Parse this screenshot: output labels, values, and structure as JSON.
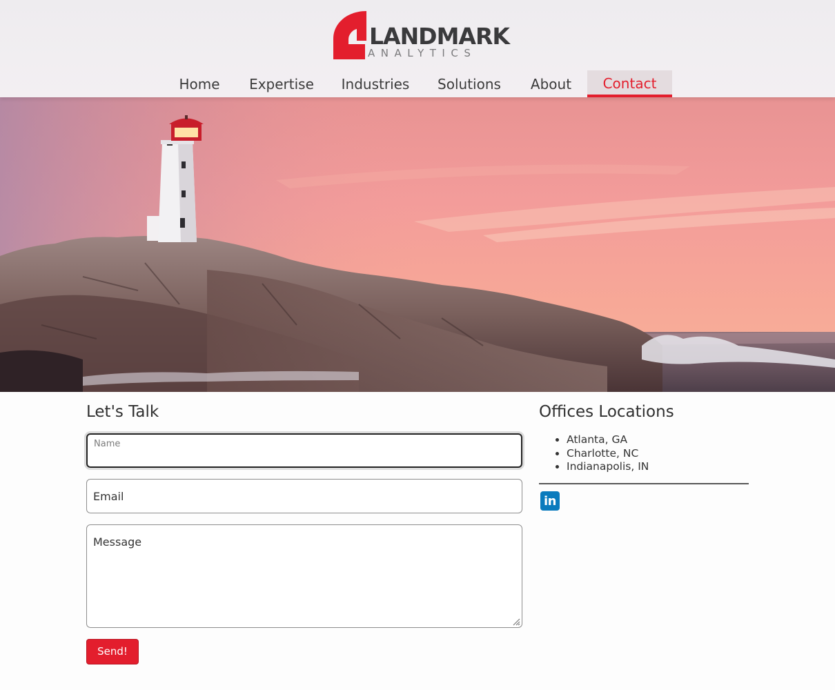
{
  "brand": {
    "name": "LANDMARK",
    "tagline": "ANALYTICS",
    "accent_color": "#e31e2d"
  },
  "nav": {
    "items": [
      {
        "label": "Home"
      },
      {
        "label": "Expertise"
      },
      {
        "label": "Industries"
      },
      {
        "label": "Solutions"
      },
      {
        "label": "About"
      },
      {
        "label": "Contact",
        "active": true
      }
    ]
  },
  "hero": {
    "image": "lighthouse-on-rocky-coast-at-sunset"
  },
  "contact": {
    "title": "Let's Talk",
    "name_label": "Name",
    "email_label": "Email",
    "message_label": "Message",
    "submit_label": "Send!"
  },
  "offices": {
    "title": "Offices Locations",
    "locations": [
      "Atlanta, GA",
      "Charlotte, NC",
      "Indianapolis, IN"
    ],
    "social_icon": "linkedin-icon",
    "social_text": "in"
  }
}
